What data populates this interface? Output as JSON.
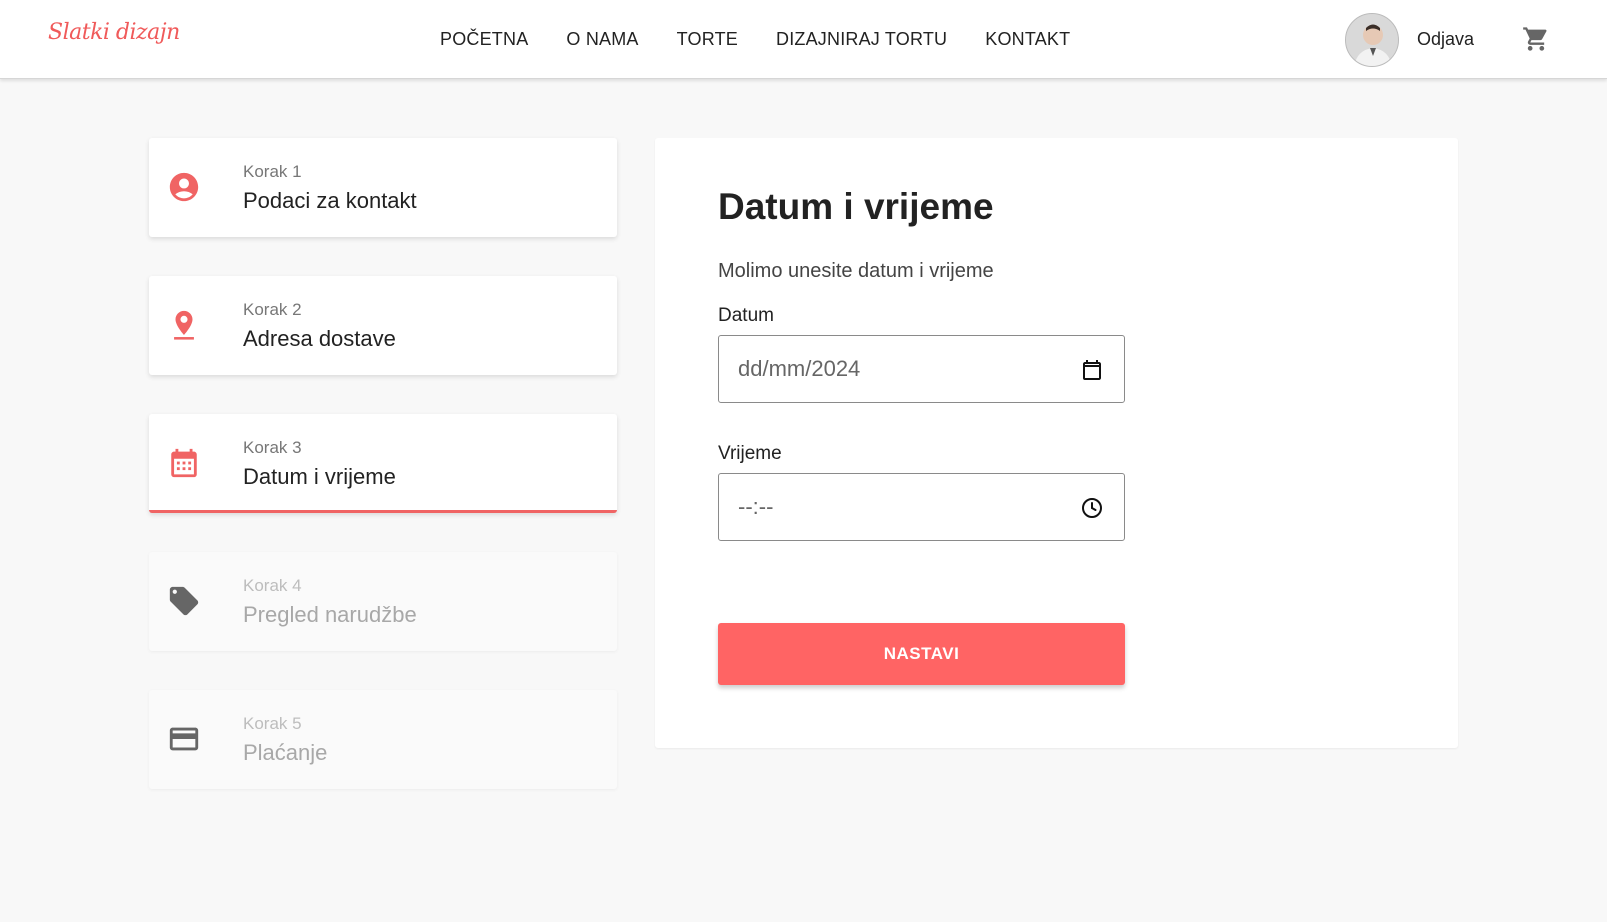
{
  "brand": {
    "logo_text": "Slatki dizajn",
    "accent_color": "#ff6464"
  },
  "nav": {
    "links": [
      {
        "label": "POČETNA"
      },
      {
        "label": "O NAMA"
      },
      {
        "label": "TORTE"
      },
      {
        "label": "DIZAJNIRAJ TORTU"
      },
      {
        "label": "KONTAKT"
      }
    ],
    "logout_label": "Odjava",
    "cart_icon": "shopping-cart-icon",
    "avatar_icon": "user-avatar"
  },
  "steps": [
    {
      "number": "Korak 1",
      "label": "Podaci za kontakt",
      "icon": "account-circle-icon",
      "state": "done"
    },
    {
      "number": "Korak 2",
      "label": "Adresa dostave",
      "icon": "location-pin-icon",
      "state": "done"
    },
    {
      "number": "Korak 3",
      "label": "Datum i vrijeme",
      "icon": "calendar-icon",
      "state": "active"
    },
    {
      "number": "Korak 4",
      "label": "Pregled narudžbe",
      "icon": "tag-icon",
      "state": "disabled"
    },
    {
      "number": "Korak 5",
      "label": "Plaćanje",
      "icon": "credit-card-icon",
      "state": "disabled"
    }
  ],
  "form": {
    "title": "Datum i vrijeme",
    "subtitle": "Molimo unesite datum i vrijeme",
    "date_label": "Datum",
    "date_value": "dd/mm/2024",
    "time_label": "Vrijeme",
    "time_value": "--:--",
    "submit_label": "NASTAVI"
  }
}
